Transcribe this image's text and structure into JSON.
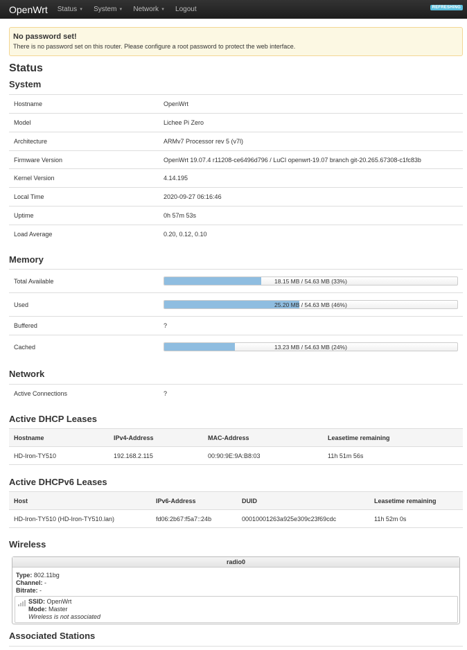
{
  "navbar": {
    "brand": "OpenWrt",
    "menu": [
      "Status",
      "System",
      "Network",
      "Logout"
    ],
    "badge": "REFRESHING"
  },
  "alert": {
    "title": "No password set!",
    "message": "There is no password set on this router. Please configure a root password to protect the web interface."
  },
  "page_title": "Status",
  "system": {
    "heading": "System",
    "rows": [
      {
        "label": "Hostname",
        "value": "OpenWrt"
      },
      {
        "label": "Model",
        "value": "Lichee Pi Zero"
      },
      {
        "label": "Architecture",
        "value": "ARMv7 Processor rev 5 (v7l)"
      },
      {
        "label": "Firmware Version",
        "value": "OpenWrt 19.07.4 r11208-ce6496d796 / LuCI openwrt-19.07 branch git-20.265.67308-c1fc83b"
      },
      {
        "label": "Kernel Version",
        "value": "4.14.195"
      },
      {
        "label": "Local Time",
        "value": "2020-09-27 06:16:46"
      },
      {
        "label": "Uptime",
        "value": "0h 57m 53s"
      },
      {
        "label": "Load Average",
        "value": "0.20, 0.12, 0.10"
      }
    ]
  },
  "memory": {
    "heading": "Memory",
    "rows": [
      {
        "label": "Total Available",
        "text": "18.15 MB / 54.63 MB (33%)",
        "percent": 33
      },
      {
        "label": "Used",
        "text": "25.20 MB / 54.63 MB (46%)",
        "percent": 46
      },
      {
        "label": "Buffered",
        "value": "?"
      },
      {
        "label": "Cached",
        "text": "13.23 MB / 54.63 MB (24%)",
        "percent": 24
      }
    ]
  },
  "network": {
    "heading": "Network",
    "rows": [
      {
        "label": "Active Connections",
        "value": "?"
      }
    ]
  },
  "dhcp": {
    "heading": "Active DHCP Leases",
    "columns": [
      "Hostname",
      "IPv4-Address",
      "MAC-Address",
      "Leasetime remaining"
    ],
    "rows": [
      [
        "HD-Iron-TY510",
        "192.168.2.115",
        "00:90:9E:9A:B8:03",
        "11h 51m 56s"
      ]
    ]
  },
  "dhcpv6": {
    "heading": "Active DHCPv6 Leases",
    "columns": [
      "Host",
      "IPv6-Address",
      "DUID",
      "Leasetime remaining"
    ],
    "rows": [
      [
        "HD-Iron-TY510 (HD-Iron-TY510.lan)",
        "fd06:2b67:f5a7::24b",
        "00010001263a925e309c23f69cdc",
        "11h 52m 0s"
      ]
    ]
  },
  "wireless": {
    "heading": "Wireless",
    "radio": {
      "name": "radio0",
      "type_label": "Type:",
      "type_value": "802.11bg",
      "channel_label": "Channel:",
      "channel_value": "-",
      "bitrate_label": "Bitrate:",
      "bitrate_value": "-",
      "ssid_label": "SSID:",
      "ssid_value": "OpenWrt",
      "mode_label": "Mode:",
      "mode_value": "Master",
      "status": "Wireless is not associated"
    }
  },
  "stations_heading": "Associated Stations"
}
